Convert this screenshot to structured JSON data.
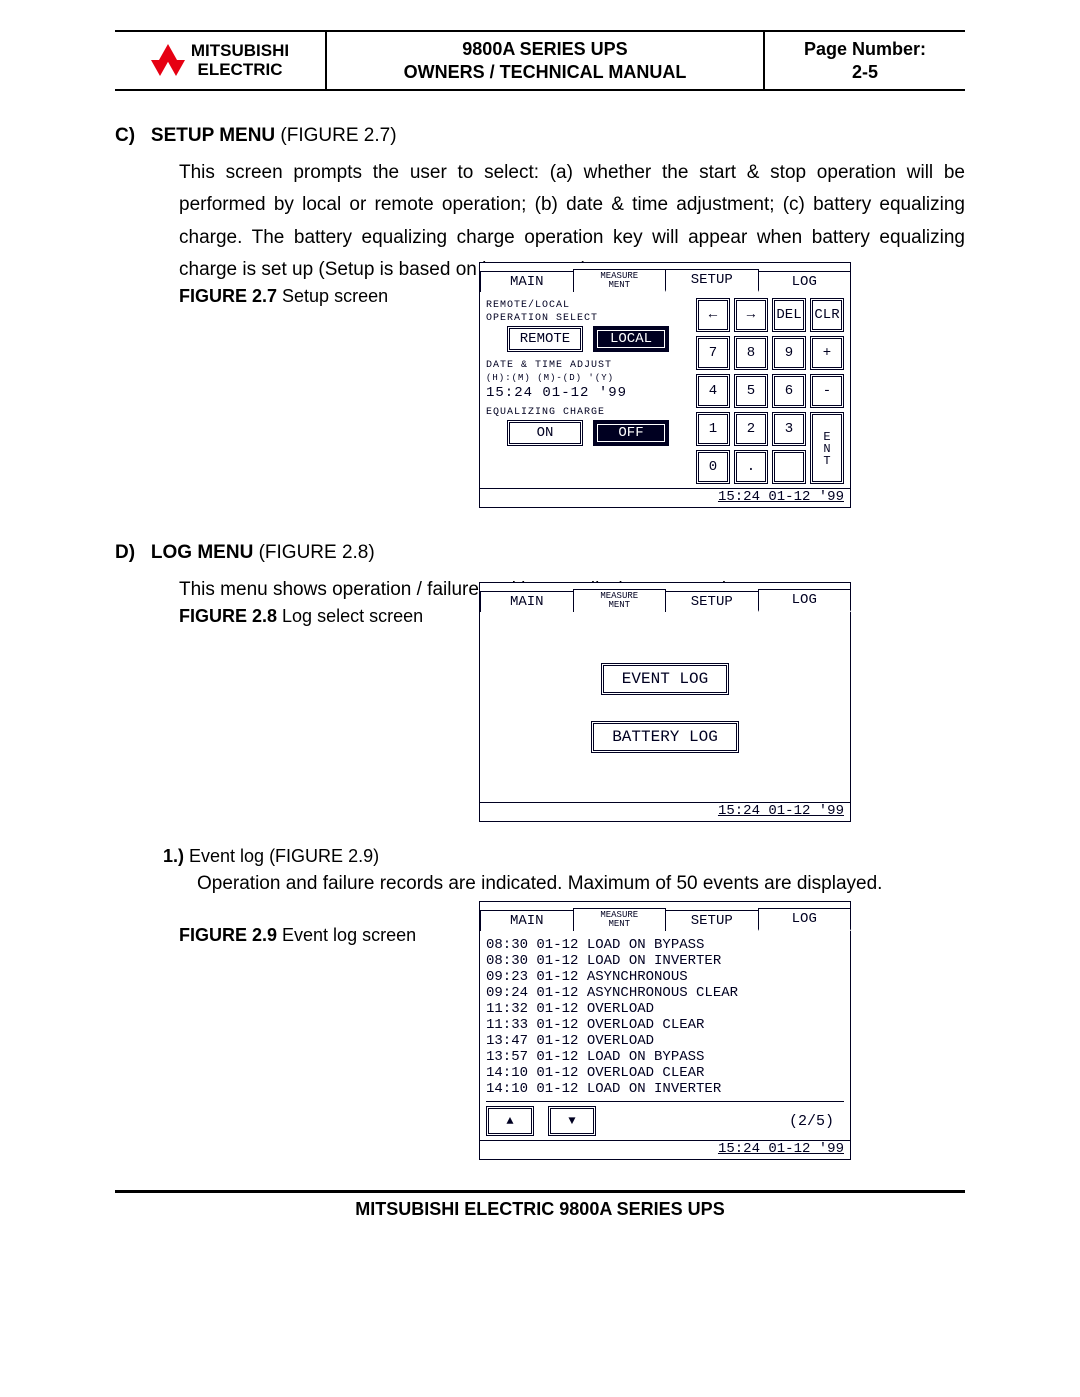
{
  "header": {
    "brand_top": "MITSUBISHI",
    "brand_bot": "ELECTRIC",
    "title_l1": "9800A SERIES UPS",
    "title_l2": "OWNERS / TECHNICAL MANUAL",
    "page_label": "Page Number:",
    "page_num": "2-5"
  },
  "sec_c": {
    "heading_letter": "C)",
    "heading_bold": "SETUP MENU",
    "heading_rest": " (FIGURE 2.7)",
    "paragraph": "This screen prompts the user to select: (a) whether the start & stop operation will be performed by local or remote operation; (b) date & time adjustment; (c) battery equalizing charge. The battery equalizing charge operation key will appear when battery equalizing charge is set up (Setup is based on battery type).",
    "fig_label_bold": "FIGURE 2.7",
    "fig_label_rest": "   Setup   screen"
  },
  "fig27": {
    "tabs": [
      "MAIN",
      "MEASURE\nMENT",
      "SETUP",
      "LOG"
    ],
    "active_tab": 2,
    "grp1_t1": "REMOTE/LOCAL",
    "grp1_t2": "OPERATION SELECT",
    "btn_remote": "REMOTE",
    "btn_local": "LOCAL",
    "grp2_t1": "DATE & TIME ADJUST",
    "grp2_t2": "(H):(M) (M)-(D) '(Y)",
    "datetime": "15:24  01-12  '99",
    "grp3_t1": "EQUALIZING CHARGE",
    "btn_on": "ON",
    "btn_off": "OFF",
    "keypad": [
      "←",
      "→",
      "DEL",
      "CLR",
      "7",
      "8",
      "9",
      "+",
      "4",
      "5",
      "6",
      "-",
      "1",
      "2",
      "3",
      "ENT",
      "0",
      ".",
      ""
    ],
    "status": "15:24 01-12 '99"
  },
  "sec_d": {
    "heading_letter": "D)",
    "heading_bold": "LOG MENU",
    "heading_rest": " (FIGURE 2.8)",
    "paragraph": "This menu shows operation / failure and battery discharge records.",
    "fig_label_bold": "FIGURE 2.8",
    "fig_label_rest": "   Log select screen"
  },
  "fig28": {
    "tabs": [
      "MAIN",
      "MEASURE\nMENT",
      "SETUP",
      "LOG"
    ],
    "active_tab": 3,
    "btn_event": "EVENT LOG",
    "btn_batt": "BATTERY LOG",
    "status": "15:24 01-12 '99"
  },
  "sub1": {
    "label_bold": "1.)",
    "label_rest": " Event log (FIGURE 2.9)",
    "paragraph": "Operation and failure records are indicated. Maximum of 50 events are displayed."
  },
  "fig29_label": {
    "bold": "FIGURE 2.9",
    "rest": "   Event log screen"
  },
  "fig29": {
    "tabs": [
      "MAIN",
      "MEASURE\nMENT",
      "SETUP",
      "LOG"
    ],
    "active_tab": 3,
    "rows": [
      "08:30 01-12 LOAD ON BYPASS",
      "08:30 01-12 LOAD ON INVERTER",
      "09:23 01-12 ASYNCHRONOUS",
      "09:24 01-12 ASYNCHRONOUS CLEAR",
      "11:32 01-12 OVERLOAD",
      "11:33 01-12 OVERLOAD CLEAR",
      "13:47 01-12 OVERLOAD",
      "13:57 01-12 LOAD ON BYPASS",
      "14:10 01-12 OVERLOAD CLEAR",
      "14:10 01-12 LOAD ON INVERTER"
    ],
    "arrow_up": "▲",
    "arrow_dn": "▼",
    "page": "(2/5)",
    "status": "15:24 01-12 '99"
  },
  "footer": "MITSUBISHI ELECTRIC 9800A SERIES UPS"
}
